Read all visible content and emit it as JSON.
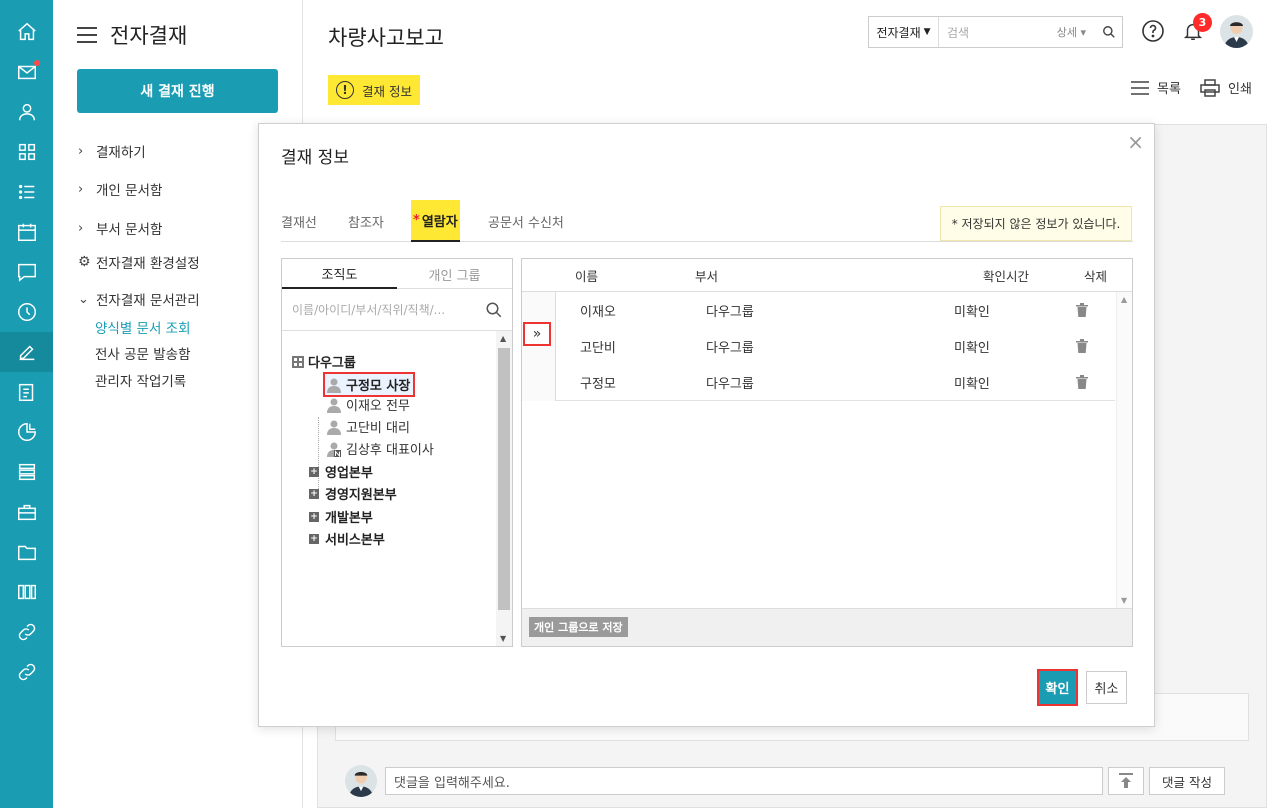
{
  "sidebar": {
    "title": "전자결재",
    "new_button": "새 결재 진행",
    "items": [
      {
        "label": "결재하기"
      },
      {
        "label": "개인 문서함"
      },
      {
        "label": "부서 문서함"
      },
      {
        "label": "전자결재 환경설정"
      },
      {
        "label": "전자결재 문서관리"
      }
    ],
    "subitems": [
      {
        "label": "양식별 문서 조회"
      },
      {
        "label": "전사 공문 발송함"
      },
      {
        "label": "관리자 작업기록"
      }
    ]
  },
  "rail": {
    "icons": [
      "home-icon",
      "mail-icon",
      "user-icon",
      "grid-icon",
      "list-icon",
      "calendar-icon",
      "chat-icon",
      "clock-icon",
      "edit-icon",
      "report-icon",
      "chart-icon",
      "db-icon",
      "briefcase-icon",
      "folder-icon",
      "apps-icon",
      "link-icon",
      "link2-icon"
    ]
  },
  "header": {
    "page_title": "차량사고보고",
    "search_scope": "전자결재",
    "search_placeholder": "검색",
    "search_detail": "상세",
    "notification_count": "3",
    "info_tag": "결재 정보",
    "list_label": "목록",
    "print_label": "인쇄"
  },
  "modal": {
    "title": "결재 정보",
    "close": "×",
    "tabs": [
      {
        "label": "결재선"
      },
      {
        "label": "참조자"
      },
      {
        "label": "열람자",
        "required": "*"
      },
      {
        "label": "공문서 수신처"
      }
    ],
    "notice": "* 저장되지 않은 정보가 있습니다.",
    "org_tabs": [
      "조직도",
      "개인 그룹"
    ],
    "org_search_placeholder": "이름/아이디/부서/직위/직책/...",
    "tree": {
      "root": "다우그룹",
      "members": [
        "구정모 사장",
        "이재오 전무",
        "고단비 대리",
        "김상후 대표이사"
      ],
      "departments": [
        "영업본부",
        "경영지원본부",
        "개발본부",
        "서비스본부"
      ]
    },
    "move_button": "»",
    "columns": [
      "이름",
      "부서",
      "확인시간",
      "삭제"
    ],
    "rows": [
      {
        "name": "이재오",
        "dept": "다우그룹",
        "status": "미확인"
      },
      {
        "name": "고단비",
        "dept": "다우그룹",
        "status": "미확인"
      },
      {
        "name": "구정모",
        "dept": "다우그룹",
        "status": "미확인"
      }
    ],
    "save_group": "개인 그룹으로 저장",
    "confirm": "확인",
    "cancel": "취소"
  },
  "comment": {
    "placeholder": "댓글을 입력해주세요.",
    "submit": "댓글 작성"
  },
  "colors": {
    "accent": "#1a9db3",
    "highlight": "#ffe834",
    "alert": "#ff2b2b"
  }
}
